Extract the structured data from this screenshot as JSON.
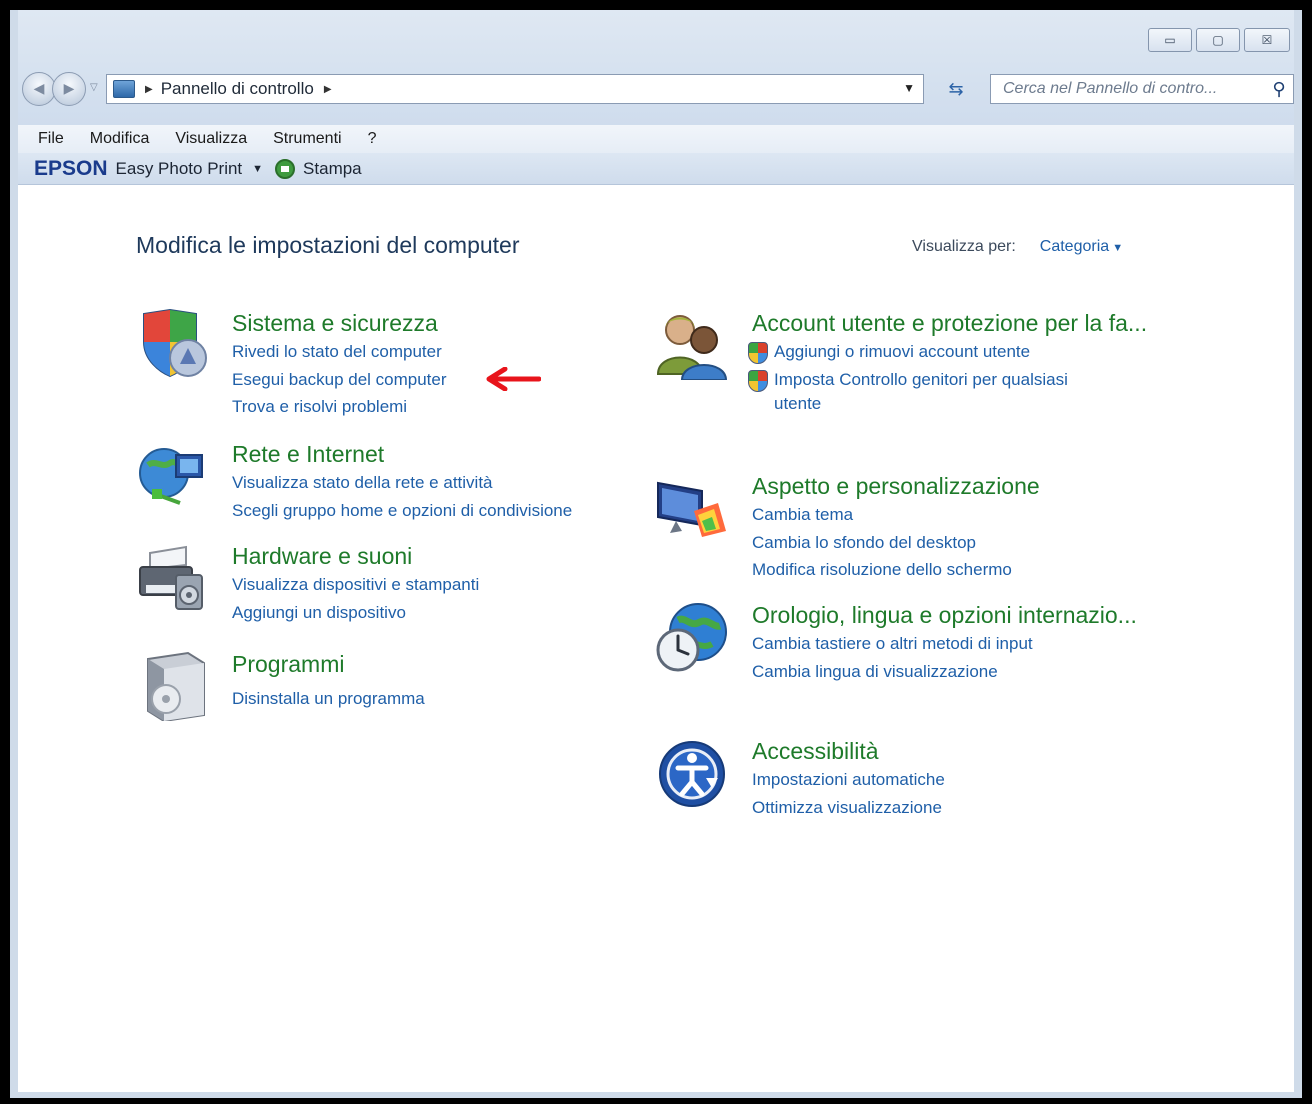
{
  "window": {
    "caption_buttons": {
      "minimize": "▭",
      "maximize": "▢",
      "close": "☒"
    }
  },
  "nav": {
    "back_icon": "◀",
    "forward_icon": "▶",
    "recent_icon": "▽",
    "breadcrumb": "Pannello di controllo",
    "breadcrumb_sep": "▶",
    "dropdown_icon": "▼",
    "refresh_icon": "⇆",
    "search_placeholder": "Cerca nel Pannello di contro...",
    "search_icon": "⚲"
  },
  "menu": [
    "File",
    "Modifica",
    "Visualizza",
    "Strumenti",
    "?"
  ],
  "toolbar": {
    "brand": "EPSON",
    "app": "Easy Photo Print",
    "drop": "▼",
    "print": "Stampa"
  },
  "main": {
    "title": "Modifica le impostazioni del computer",
    "view_by_label": "Visualizza per:",
    "view_by_value": "Categoria"
  },
  "categories": {
    "sistema": {
      "title": "Sistema e sicurezza",
      "links": [
        "Rivedi lo stato del computer",
        "Esegui backup del computer",
        "Trova e risolvi problemi"
      ]
    },
    "rete": {
      "title": "Rete e Internet",
      "links": [
        "Visualizza stato della rete e attività",
        "Scegli gruppo home e opzioni di condivisione"
      ]
    },
    "hardware": {
      "title": "Hardware e suoni",
      "links": [
        "Visualizza dispositivi e stampanti",
        "Aggiungi un dispositivo"
      ]
    },
    "programmi": {
      "title": "Programmi",
      "links": [
        "Disinstalla un programma"
      ]
    },
    "account": {
      "title": "Account utente e protezione per la fa...",
      "links": [
        "Aggiungi o rimuovi account utente",
        "Imposta Controllo genitori per qualsiasi",
        "utente"
      ]
    },
    "aspetto": {
      "title": "Aspetto e personalizzazione",
      "links": [
        "Cambia tema",
        "Cambia lo sfondo del desktop",
        "Modifica risoluzione dello schermo"
      ]
    },
    "orologio": {
      "title": "Orologio, lingua e opzioni internazio...",
      "links": [
        "Cambia tastiere o altri metodi di input",
        "Cambia lingua di visualizzazione"
      ]
    },
    "accessibilita": {
      "title": "Accessibilità",
      "links": [
        "Impostazioni automatiche",
        "Ottimizza visualizzazione"
      ]
    }
  },
  "colors": {
    "category_title": "#1e7a2a",
    "link": "#1f5fa8",
    "annotation_arrow": "#e8141b"
  }
}
